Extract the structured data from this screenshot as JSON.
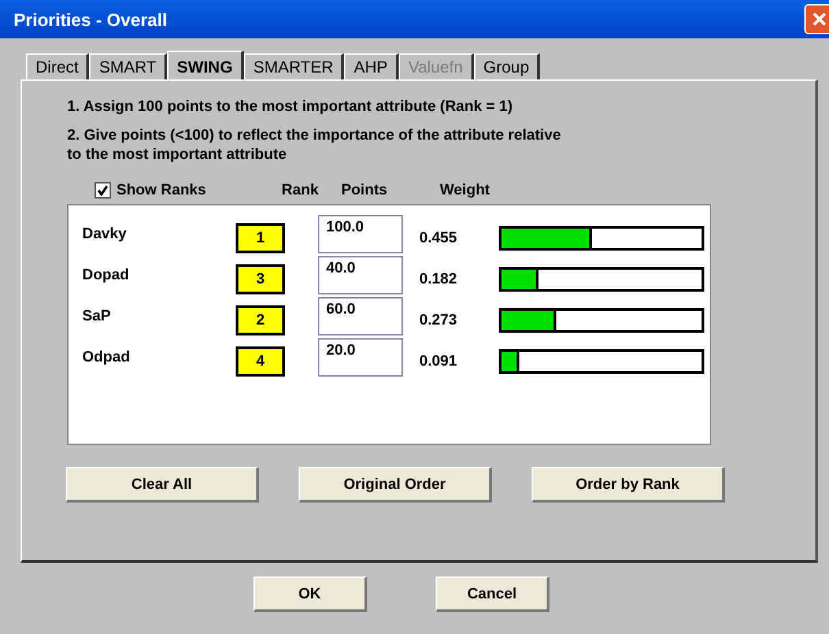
{
  "window": {
    "title": "Priorities - Overall"
  },
  "tabs": [
    {
      "label": "Direct",
      "selected": false,
      "disabled": false
    },
    {
      "label": "SMART",
      "selected": false,
      "disabled": false
    },
    {
      "label": "SWING",
      "selected": true,
      "disabled": false
    },
    {
      "label": "SMARTER",
      "selected": false,
      "disabled": false
    },
    {
      "label": "AHP",
      "selected": false,
      "disabled": false
    },
    {
      "label": "Valuefn",
      "selected": false,
      "disabled": true
    },
    {
      "label": "Group",
      "selected": false,
      "disabled": false
    }
  ],
  "instructions": [
    "1. Assign 100 points to the most important attribute (Rank = 1)",
    "2. Give points (<100) to reflect the importance of the attribute relative\nto the most important attribute"
  ],
  "show_ranks": {
    "label": "Show Ranks",
    "checked": true
  },
  "columns": [
    "Rank",
    "Points",
    "Weight"
  ],
  "attributes": [
    {
      "name": "Davky",
      "rank": "1",
      "points": "100.0",
      "weight": "0.455",
      "level": 0.455
    },
    {
      "name": "Dopad",
      "rank": "3",
      "points": "40.0",
      "weight": "0.182",
      "level": 0.182
    },
    {
      "name": "SaP",
      "rank": "2",
      "points": "60.0",
      "weight": "0.273",
      "level": 0.273
    },
    {
      "name": "Odpad",
      "rank": "4",
      "points": "20.0",
      "weight": "0.091",
      "level": 0.091
    }
  ],
  "panel_buttons": [
    "Clear All",
    "Original Order",
    "Order by Rank"
  ],
  "dialog_buttons": [
    "OK",
    "Cancel"
  ]
}
